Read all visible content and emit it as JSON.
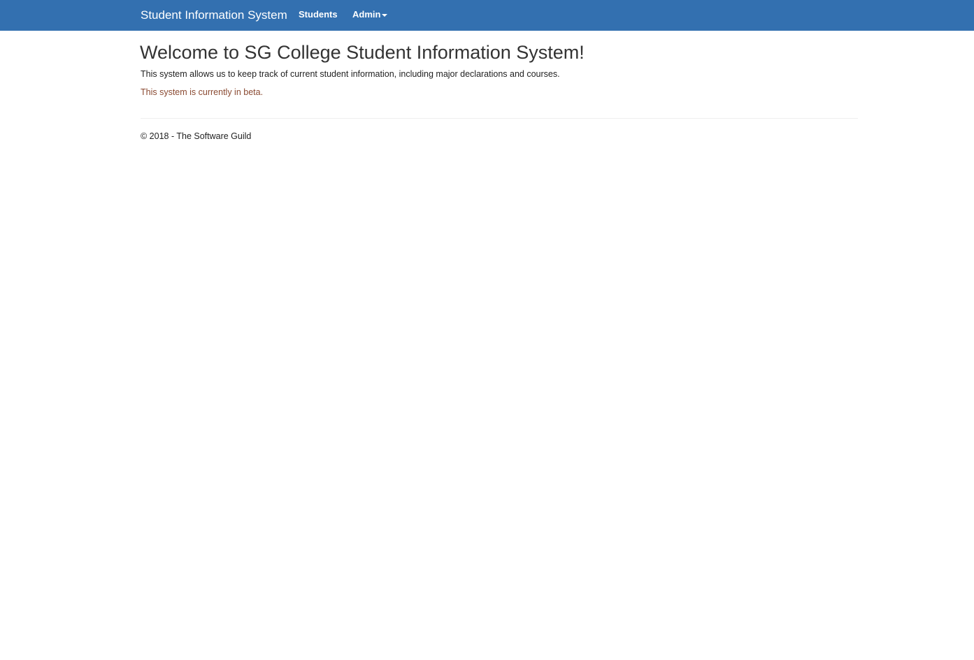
{
  "navbar": {
    "brand": "Student Information System",
    "items": [
      {
        "label": "Students"
      },
      {
        "label": "Admin",
        "has_dropdown": true
      }
    ],
    "background_color": "#3370b0"
  },
  "main": {
    "title": "Welcome to SG College Student Information System!",
    "intro": "This system allows us to keep track of current student information, including major declarations and courses.",
    "beta_notice": "This system is currently in beta.",
    "beta_color": "#8a4a32"
  },
  "footer": {
    "text": "© 2018 - The Software Guild"
  }
}
